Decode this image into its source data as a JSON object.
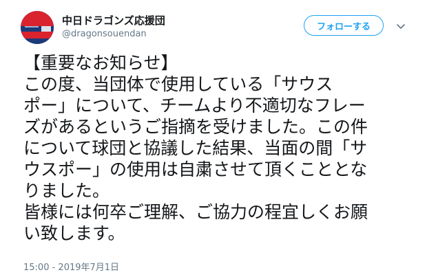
{
  "author": {
    "display_name": "中日ドラゴンズ応援団",
    "handle": "@dragonsouendan",
    "avatar_colors": {
      "red": "#d9232e",
      "blue": "#1b3a7a"
    }
  },
  "follow_button": {
    "label": "フォローする",
    "color": "#1da1f2"
  },
  "more_menu": {
    "icon": "chevron-down-icon"
  },
  "tweet": {
    "text": "【重要なお知らせ】\nこの度、当団体で使用している「サウス\nポー」について、チームより不適切なフレー\nズがあるというご指摘を受けました。この件\nについて球団と協議した結果、当面の間「サ\nウスポー」の使用は自粛させて頂くこととな\nりました。\n皆様には何卒ご理解、ご協力の程宜しくお願\nい致します。",
    "timestamp": "15:00 - 2019年7月1日"
  }
}
